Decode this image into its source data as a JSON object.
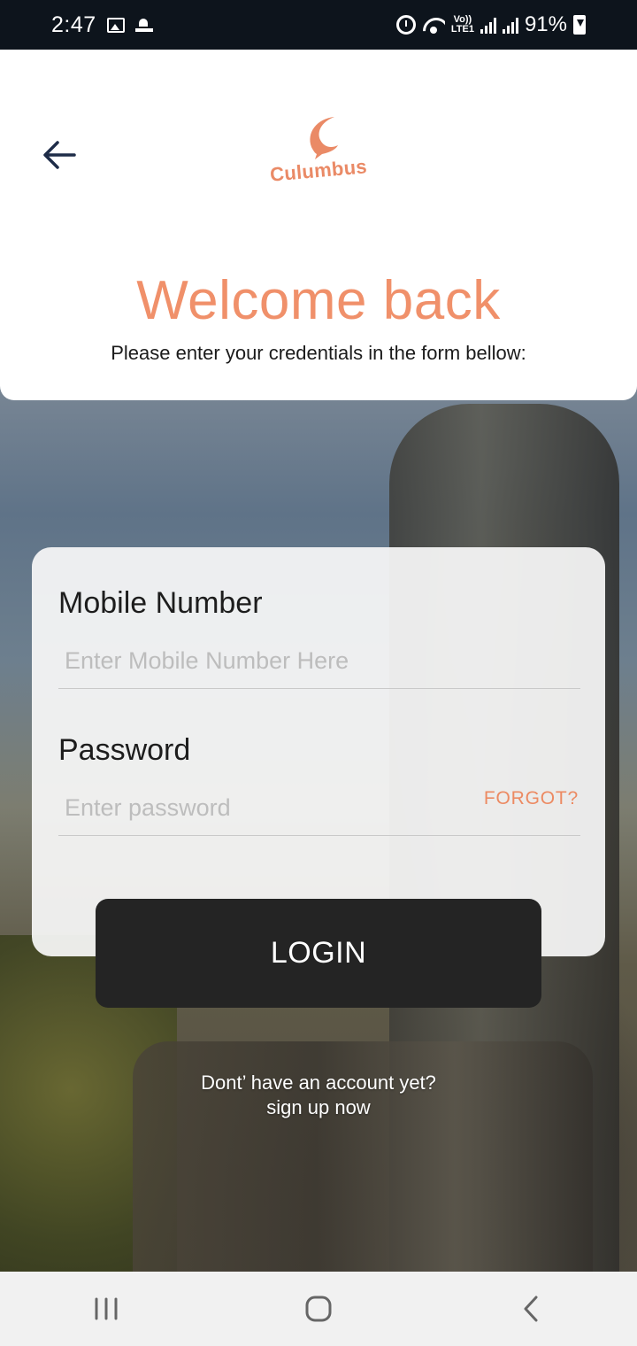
{
  "status_bar": {
    "time": "2:47",
    "volte_label": "Vo))\nLTE1",
    "battery": "91%",
    "icons": [
      "gallery-icon",
      "satellite-icon",
      "alarm-icon",
      "wifi-icon",
      "signal-icon",
      "signal-icon",
      "battery-charging-icon"
    ]
  },
  "header": {
    "back_icon": "arrow-left-icon",
    "logo_text": "Culumbus",
    "title": "Welcome back",
    "subtitle": "Please enter your credentials in the form bellow:"
  },
  "form": {
    "mobile": {
      "label": "Mobile Number",
      "placeholder": "Enter Mobile Number Here",
      "value": ""
    },
    "password": {
      "label": "Password",
      "placeholder": "Enter password",
      "value": ""
    },
    "forgot_label": "FORGOT?"
  },
  "login_label": "LOGIN",
  "signup": {
    "line1": "Dont’ have an account yet?",
    "line2": "sign up now"
  },
  "nav": {
    "icons": [
      "recent-apps-icon",
      "home-icon",
      "back-icon"
    ]
  },
  "colors": {
    "accent": "#f0906a",
    "button": "#242424",
    "status_bar": "#0d141c"
  }
}
